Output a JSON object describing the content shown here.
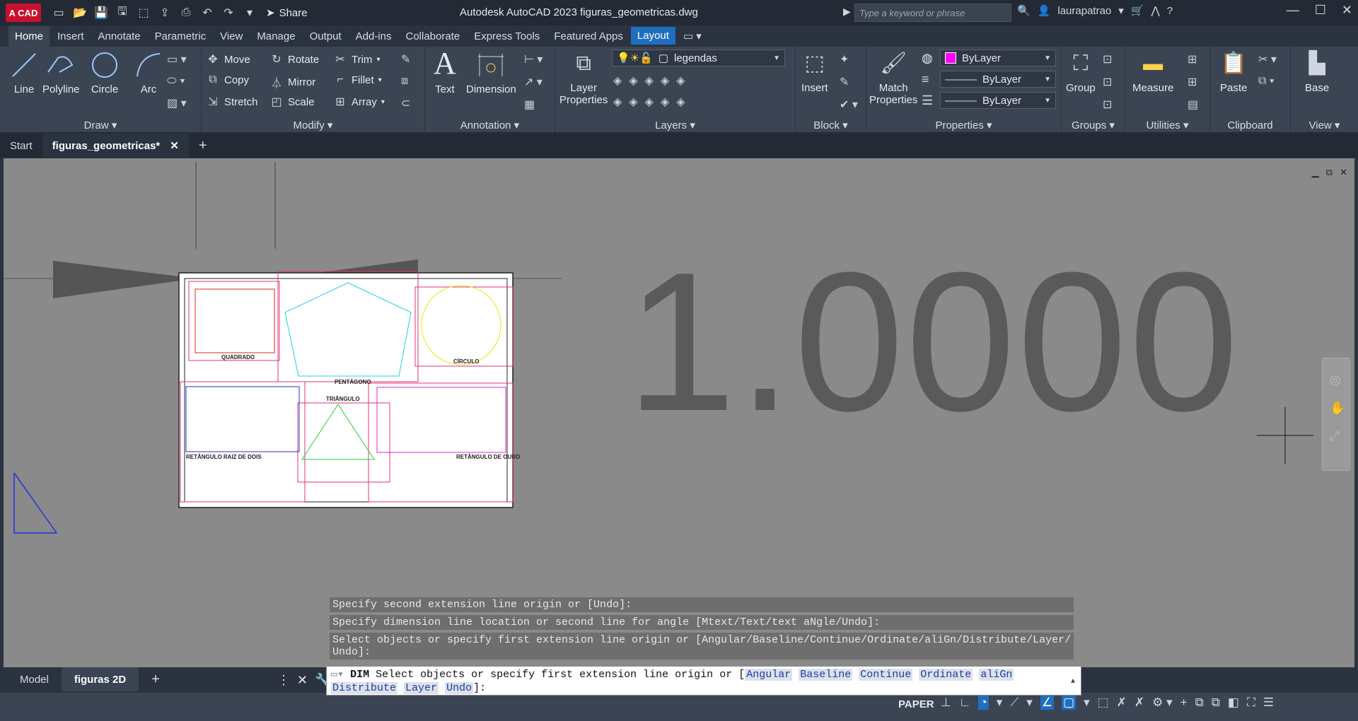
{
  "titlebar": {
    "logo": "A CAD",
    "share": "Share",
    "title": "Autodesk AutoCAD 2023    figuras_geometricas.dwg",
    "search_placeholder": "Type a keyword or phrase",
    "user": "laurapatrao"
  },
  "ribbon_tabs": [
    "Home",
    "Insert",
    "Annotate",
    "Parametric",
    "View",
    "Manage",
    "Output",
    "Add-ins",
    "Collaborate",
    "Express Tools",
    "Featured Apps",
    "Layout"
  ],
  "panels": {
    "draw": {
      "title": "Draw",
      "line": "Line",
      "polyline": "Polyline",
      "circle": "Circle",
      "arc": "Arc"
    },
    "modify": {
      "title": "Modify",
      "move": "Move",
      "rotate": "Rotate",
      "trim": "Trim",
      "copy": "Copy",
      "mirror": "Mirror",
      "fillet": "Fillet",
      "stretch": "Stretch",
      "scale": "Scale",
      "array": "Array"
    },
    "annotation": {
      "title": "Annotation",
      "text": "Text",
      "dimension": "Dimension"
    },
    "layers": {
      "title": "Layers",
      "layer_properties_1": "Layer",
      "layer_properties_2": "Properties",
      "current_layer": "legendas"
    },
    "block": {
      "title": "Block",
      "insert": "Insert"
    },
    "properties": {
      "title": "Properties",
      "match_1": "Match",
      "match_2": "Properties",
      "color": "ByLayer",
      "linetype": "ByLayer",
      "lineweight": "ByLayer"
    },
    "groups": {
      "title": "Groups",
      "group": "Group"
    },
    "utilities": {
      "title": "Utilities",
      "measure": "Measure"
    },
    "clipboard": {
      "title": "Clipboard",
      "paste": "Paste"
    },
    "view": {
      "title": "View",
      "base": "Base"
    }
  },
  "doc_tabs": {
    "start": "Start",
    "active": "figuras_geometricas*"
  },
  "drawing": {
    "dimension_text": "1.0000",
    "labels": {
      "quadrado": "QUADRADO",
      "pentagono": "PENTÁGONO",
      "circulo": "CÍRCULO",
      "triangulo": "TRIÂNGULO",
      "retangulo_raiz": "RETÂNGULO RAIZ DE DOIS",
      "retangulo_ouro": "RETÂNGULO DE OURO"
    }
  },
  "command": {
    "history": [
      "Specify second extension line origin or [Undo]:",
      "Specify dimension line location or second line for angle [Mtext/Text/text aNgle/Undo]:",
      "Select objects or specify first extension line origin or [Angular/Baseline/Continue/Ordinate/aliGn/Distribute/Layer/",
      "Undo]:"
    ],
    "prompt_cmd": "DIM",
    "prompt_text": "Select objects or specify first extension line origin or [",
    "options_line1": [
      "Angular",
      "Baseline",
      "Continue",
      "Ordinate",
      "aliGn"
    ],
    "options_line2": [
      "Distribute",
      "Layer",
      "Undo"
    ],
    "prompt_end": "]:"
  },
  "layout_tabs": {
    "model": "Model",
    "active": "figuras 2D"
  },
  "status": {
    "paper": "PAPER"
  },
  "colors": {
    "accent": "#1f6fc0",
    "canvas": "#8a8a8a",
    "ribbon": "#3b4453"
  }
}
